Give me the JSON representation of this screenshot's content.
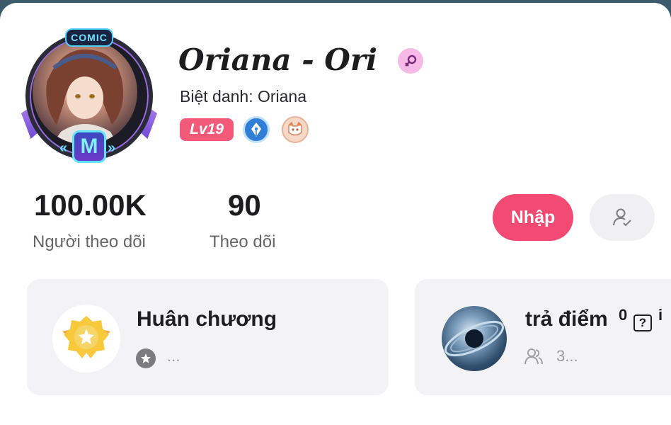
{
  "profile": {
    "avatar_brand": "COMIC",
    "avatar_badge_letter": "M",
    "name": "Oriana - Ori",
    "gender_icon": "female-icon",
    "nickname": "Biệt danh: Oriana",
    "level": "Lv19",
    "badges": [
      "pen-nib-icon",
      "cat-icon"
    ]
  },
  "stats": [
    {
      "value": "100.00K",
      "label": "Người theo dõi"
    },
    {
      "value": "90",
      "label": "Theo dõi"
    }
  ],
  "actions": {
    "enter_label": "Nhập",
    "follow_icon": "user-check-icon"
  },
  "cards": {
    "medal": {
      "title": "Huân chương",
      "sub": "..."
    },
    "points": {
      "title": "trả điểm",
      "superscript": "0",
      "help": "?",
      "info": "i",
      "sub": "3..."
    }
  },
  "colors": {
    "accent": "#f24a72",
    "level_badge": "#f25a7a",
    "gender_badge": "#f7b9e6"
  }
}
